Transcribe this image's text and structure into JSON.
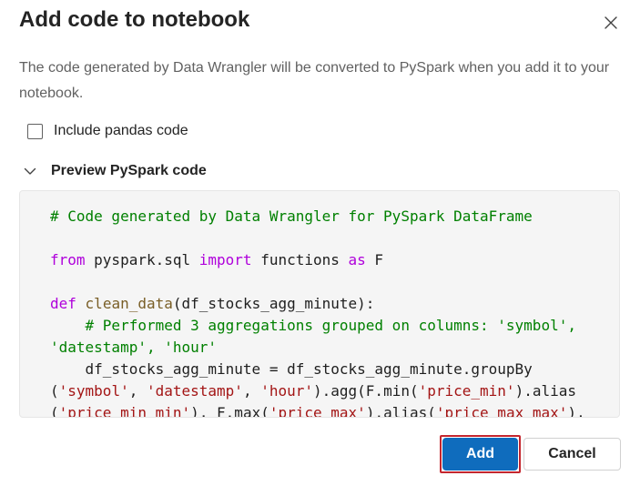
{
  "dialog": {
    "title": "Add code to notebook",
    "close_icon": "close-icon",
    "description": "The code generated by Data Wrangler will be converted to PySpark when you add it to your notebook.",
    "include_pandas": {
      "label": "Include pandas code",
      "checked": false
    },
    "preview": {
      "label": "Preview PySpark code",
      "expanded": true,
      "chevron_icon": "chevron-down-icon"
    },
    "code_lines": [
      [
        {
          "t": "comment",
          "v": "# Code generated by Data Wrangler for PySpark DataFrame"
        }
      ],
      [],
      [
        {
          "t": "keyword",
          "v": "from"
        },
        {
          "t": "default",
          "v": " pyspark.sql "
        },
        {
          "t": "keyword",
          "v": "import"
        },
        {
          "t": "default",
          "v": " functions "
        },
        {
          "t": "keyword",
          "v": "as"
        },
        {
          "t": "default",
          "v": " F"
        }
      ],
      [],
      [
        {
          "t": "keyword",
          "v": "def"
        },
        {
          "t": "default",
          "v": " "
        },
        {
          "t": "func",
          "v": "clean_data"
        },
        {
          "t": "default",
          "v": "(df_stocks_agg_minute):"
        }
      ],
      [
        {
          "t": "default",
          "v": "    "
        },
        {
          "t": "comment",
          "v": "# Performed 3 aggregations grouped on columns: 'symbol',"
        }
      ],
      [
        {
          "t": "comment",
          "v": "'datestamp', 'hour'"
        }
      ],
      [
        {
          "t": "default",
          "v": "    df_stocks_agg_minute = df_stocks_agg_minute.groupBy"
        }
      ],
      [
        {
          "t": "default",
          "v": "("
        },
        {
          "t": "str",
          "v": "'symbol'"
        },
        {
          "t": "default",
          "v": ", "
        },
        {
          "t": "str",
          "v": "'datestamp'"
        },
        {
          "t": "default",
          "v": ", "
        },
        {
          "t": "str",
          "v": "'hour'"
        },
        {
          "t": "default",
          "v": ").agg(F.min("
        },
        {
          "t": "str",
          "v": "'price_min'"
        },
        {
          "t": "default",
          "v": ").alias"
        }
      ],
      [
        {
          "t": "default",
          "v": "("
        },
        {
          "t": "str",
          "v": "'price_min_min'"
        },
        {
          "t": "default",
          "v": "), F.max("
        },
        {
          "t": "str",
          "v": "'price_max'"
        },
        {
          "t": "default",
          "v": ").alias("
        },
        {
          "t": "str",
          "v": "'price_max_max'"
        },
        {
          "t": "default",
          "v": "),"
        }
      ]
    ],
    "buttons": {
      "add_label": "Add",
      "cancel_label": "Cancel"
    }
  },
  "colors": {
    "primary": "#0f6cbd",
    "focus_outline": "#c4262e",
    "comment": "#008000",
    "keyword": "#af00db",
    "string": "#a31515",
    "function": "#795e26"
  }
}
